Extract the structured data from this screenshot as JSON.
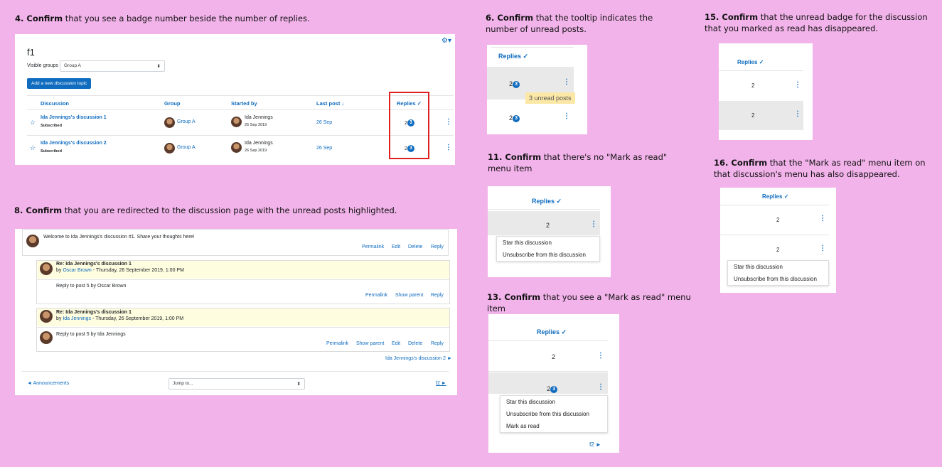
{
  "captions": {
    "c4": {
      "num": "4. Confirm",
      "rest": " that you see a badge number beside the number of replies."
    },
    "c8": {
      "num": "8. Confirm",
      "rest": " that you are redirected to the discussion page with the unread posts highlighted."
    },
    "c6": {
      "num": "6. Confirm",
      "rest": " that the tooltip indicates the number of unread posts."
    },
    "c11": {
      "num": "11. Confirm",
      "rest": " that there's no \"Mark as read\" menu item"
    },
    "c13": {
      "num": "13. Confirm",
      "rest": " that you see a \"Mark as read\" menu  item"
    },
    "c15": {
      "num": "15. Confirm",
      "rest": " that the unread badge for the discussion that you marked as read has disappeared."
    },
    "c16": {
      "num": "16. Confirm",
      "rest": " that the \"Mark as read\" menu item on that discussion's menu has also disappeared."
    }
  },
  "forum": {
    "title": "f1",
    "visible_groups_label": "Visible groups",
    "group_select": "Group A",
    "add_button": "Add a new discussion topic",
    "headers": {
      "discussion": "Discussion",
      "group": "Group",
      "started_by": "Started by",
      "last_post": "Last post",
      "replies": "Replies"
    },
    "rows": [
      {
        "title": "Ida Jennings's discussion 1",
        "status": "Subscribed",
        "group": "Group A",
        "author": "Ida Jennings",
        "date": "26 Sep 2019",
        "last_post": "26 Sep",
        "replies": "2",
        "unread": "3"
      },
      {
        "title": "Ida Jennings's discussion 2",
        "status": "Subscribed",
        "group": "Group A",
        "author": "Ida Jennings",
        "date": "26 Sep 2019",
        "last_post": "26 Sep",
        "replies": "2",
        "unread": "3"
      }
    ]
  },
  "discussion": {
    "intro": "Welcome to Ida Jennings's discussion #1. Share your thoughts here!",
    "intro_actions": [
      "Permalink",
      "Edit",
      "Delete",
      "Reply"
    ],
    "post1": {
      "title": "Re: Ida Jennings's discussion 1",
      "by": "by ",
      "author": "Oscar Brown",
      "when": " - Thursday, 26 September 2019, 1:00 PM",
      "body": "Reply to post 5 by Oscar Brown",
      "actions": [
        "Permalink",
        "Show parent",
        "Reply"
      ]
    },
    "post2": {
      "title": "Re: Ida Jennings's discussion 1",
      "by": "by ",
      "author": "Ida Jennings",
      "when": " - Thursday, 26 September 2019, 1:00 PM",
      "body": "Reply to post 5 by Ida Jennings",
      "actions": [
        "Permalink",
        "Show parent",
        "Edit",
        "Delete",
        "Reply"
      ]
    },
    "next_link": "Ida Jennings's discussion 2 ►",
    "prev_nav": "◄ Announcements",
    "jump_to": "Jump to...",
    "next_nav": "f2 ►"
  },
  "replies_header": "Replies",
  "reply_count": "2",
  "unread_count": "3",
  "tooltip": "3 unread posts",
  "menu": {
    "star": "Star this discussion",
    "unsubscribe": "Unsubscribe from this discussion",
    "mark_read": "Mark as read"
  },
  "f2_link": "f2 ►",
  "colors": {
    "background": "#f2b3ea",
    "link": "#0f6cbf",
    "highlight": "#fffde0",
    "tooltip": "#fce8a6",
    "red_box": "#e02020"
  }
}
